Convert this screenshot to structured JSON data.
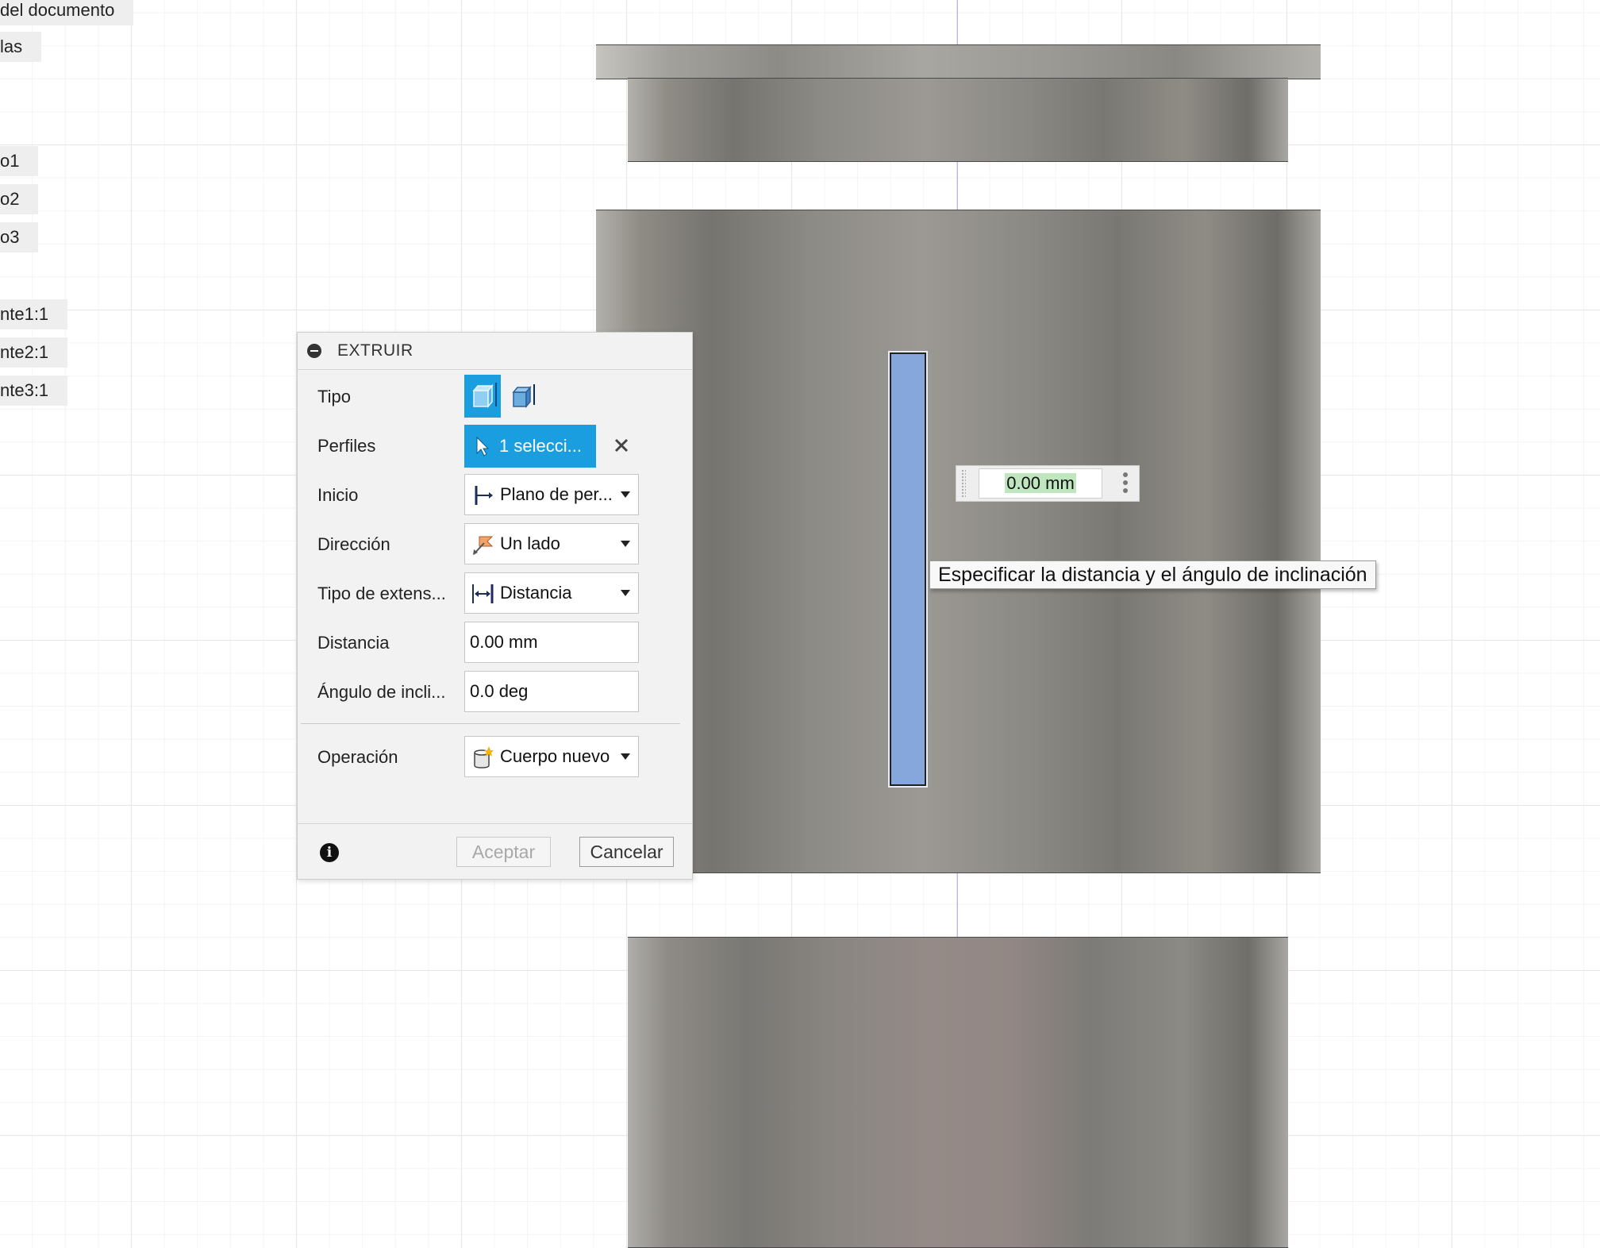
{
  "browser": {
    "items": [
      {
        "label": "del documento"
      },
      {
        "label": "las"
      },
      {
        "label": "o1"
      },
      {
        "label": "o2"
      },
      {
        "label": "o3"
      },
      {
        "label": "nte1:1"
      },
      {
        "label": "nte2:1"
      },
      {
        "label": "nte3:1"
      }
    ]
  },
  "dialog": {
    "title": "EXTRUIR",
    "rows": {
      "tipo": {
        "label": "Tipo"
      },
      "perfiles": {
        "label": "Perfiles",
        "value": "1 selecci..."
      },
      "inicio": {
        "label": "Inicio",
        "value": "Plano de per..."
      },
      "direccion": {
        "label": "Dirección",
        "value": "Un lado"
      },
      "tipo_extension": {
        "label": "Tipo de extens...",
        "value": "Distancia"
      },
      "distancia": {
        "label": "Distancia",
        "value": "0.00 mm"
      },
      "angulo": {
        "label": "Ángulo de incli...",
        "value": "0.0 deg"
      },
      "operacion": {
        "label": "Operación",
        "value": "Cuerpo nuevo"
      }
    },
    "buttons": {
      "accept": "Aceptar",
      "cancel": "Cancelar"
    }
  },
  "manipulator": {
    "value": "0.00 mm"
  },
  "tooltip": {
    "text": "Especificar la distancia y el ángulo de inclinación"
  },
  "colors": {
    "accent": "#1a9ee0",
    "profile": "#85a7dc",
    "value_highlight": "#bfe6bf"
  }
}
